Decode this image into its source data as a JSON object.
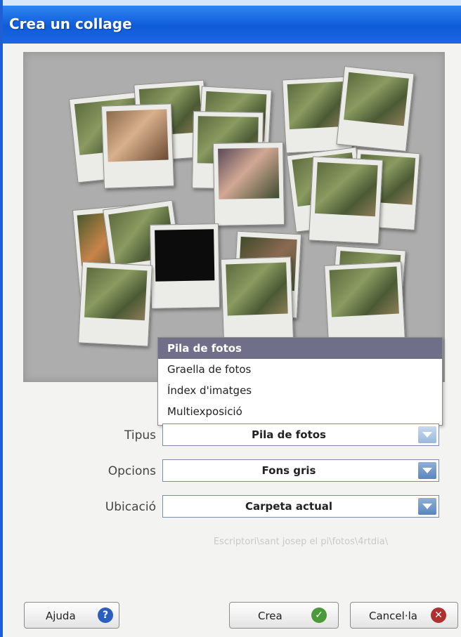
{
  "window": {
    "title": "Crea un collage"
  },
  "dropdown_menu": {
    "items": [
      "Pila de fotos",
      "Graella de fotos",
      "Índex d'imatges",
      "Multiexposició"
    ],
    "selected_index": 0
  },
  "fields": {
    "tipus": {
      "label": "Tipus",
      "value": "Pila de fotos"
    },
    "opcions": {
      "label": "Opcions",
      "value": "Fons gris"
    },
    "ubicacio": {
      "label": "Ubicació",
      "value": "Carpeta actual"
    }
  },
  "path_text": "Escriptori\\sant josep el pi\\fotos\\4rtdia\\",
  "buttons": {
    "help": "Ajuda",
    "create": "Crea",
    "cancel": "Cancel·la"
  },
  "icons": {
    "help": "help-icon",
    "create": "checkmark-icon",
    "cancel": "close-icon",
    "dropdown": "chevron-down-icon"
  },
  "colors": {
    "titlebar": "#1d67e3",
    "selected_item": "#6f6f8a",
    "help_icon": "#2a5fc0",
    "create_icon": "#4a9a3a",
    "cancel_icon": "#b03030"
  }
}
